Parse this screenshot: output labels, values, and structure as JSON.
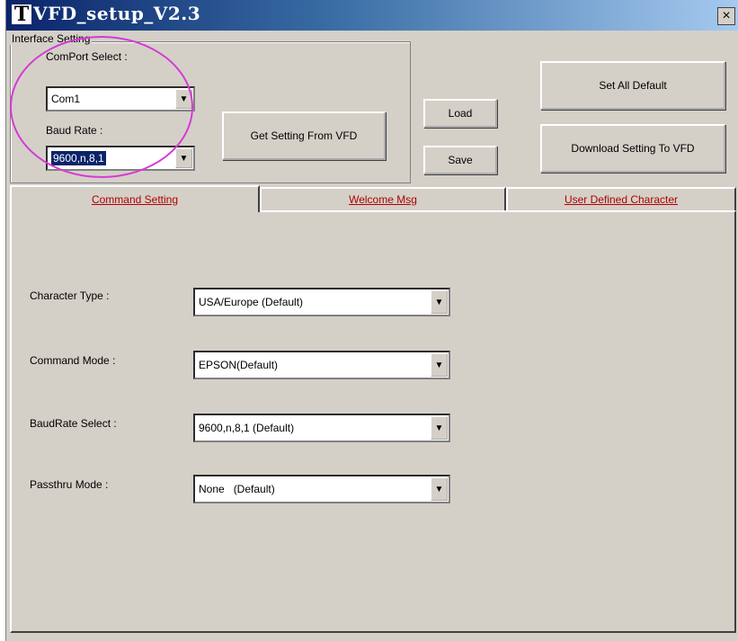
{
  "window": {
    "title": "VFD_setup_V2.3",
    "close_label": "×"
  },
  "interface": {
    "group_label": "Interface Setting",
    "comport_label": "ComPort Select :",
    "comport_value": "Com1",
    "baud_label": "Baud Rate :",
    "baud_value": "9600,n,8,1"
  },
  "buttons": {
    "get_setting": "Get Setting From VFD",
    "load": "Load",
    "save": "Save",
    "set_all_default": "Set All Default",
    "download": "Download Setting To VFD"
  },
  "tabs": [
    {
      "label": "Command Setting",
      "active": true
    },
    {
      "label": "Welcome Msg",
      "active": false
    },
    {
      "label": "User Defined Character",
      "active": false
    }
  ],
  "command": {
    "character_type_label": "Character Type :",
    "character_type_value": "USA/Europe (Default)",
    "command_mode_label": "Command Mode :",
    "command_mode_value": "EPSON(Default)",
    "baudrate_select_label": "BaudRate Select :",
    "baudrate_select_value": "9600,n,8,1 (Default)",
    "passthru_label": "Passthru Mode :",
    "passthru_value": "None   (Default)"
  },
  "colors": {
    "tab_text": "#b00000",
    "highlight_circle": "#d63ad6",
    "face": "#d4d0c8"
  }
}
